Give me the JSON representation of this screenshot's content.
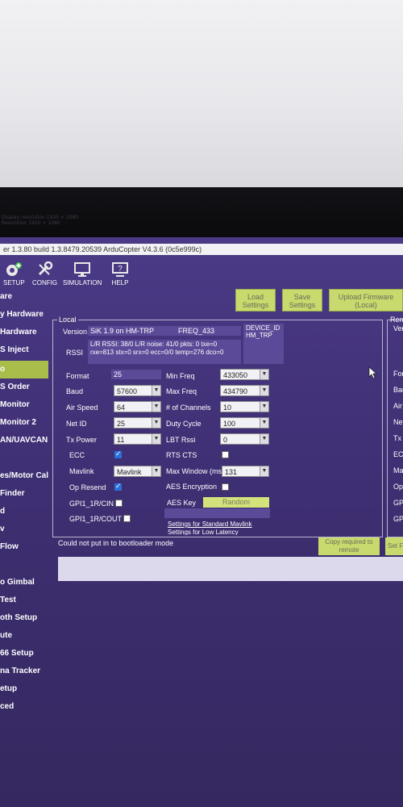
{
  "bezel_text": [
    "Display resolution 1920 × 1080",
    "Resolution 1920 × 1080"
  ],
  "window": {
    "title": "er 1.3.80 build 1.3.8479.20539 ArduCopter V4.3.6 (0c5e999c)"
  },
  "toolbar": {
    "setup": "SETUP",
    "config": "CONFIG",
    "simulation": "SIMULATION",
    "help": "HELP"
  },
  "sidebar": {
    "items": [
      {
        "label": "are"
      },
      {
        "label": "y Hardware"
      },
      {
        "label": "Hardware"
      },
      {
        "label": "S Inject"
      },
      {
        "label": "o",
        "active": true
      },
      {
        "label": "S Order"
      },
      {
        "label": "Monitor"
      },
      {
        "label": "Monitor 2"
      },
      {
        "label": "AN/UAVCAN"
      },
      {
        "label": "es/Motor Calib"
      },
      {
        "label": "Finder"
      },
      {
        "label": "d"
      },
      {
        "label": "v"
      },
      {
        "label": "Flow"
      },
      {
        "label": "o Gimbal"
      },
      {
        "label": "Test"
      },
      {
        "label": "oth Setup"
      },
      {
        "label": "ute"
      },
      {
        "label": "66 Setup"
      },
      {
        "label": "na Tracker"
      },
      {
        "label": "etup"
      },
      {
        "label": "ced"
      }
    ]
  },
  "actions": {
    "load": "Load Settings",
    "save": "Save Settings",
    "upload": "Upload Firmware (Local)"
  },
  "local": {
    "title": "Local",
    "version_label": "Version",
    "version_value": "SiK 1.9 on HM-TRP",
    "freq_value": "FREQ_433",
    "device_id": "DEVICE_ID HM_TRP",
    "rssi_label": "RSSI",
    "rssi_line1": "L/R RSSI: 38/0  L/R noise: 41/0 pkts: 0  txe=0",
    "rssi_line2": "rxe=813 stx=0 srx=0 ecc=0/0 temp=276 dco=0",
    "format_label": "Format",
    "format_value": "25",
    "baud_label": "Baud",
    "baud_value": "57600",
    "airspeed_label": "Air Speed",
    "airspeed_value": "64",
    "netid_label": "Net ID",
    "netid_value": "25",
    "txpower_label": "Tx Power",
    "txpower_value": "11",
    "ecc_label": "ECC",
    "ecc_checked": true,
    "mavlink_label": "Mavlink",
    "mavlink_value": "Mavlink",
    "opresend_label": "Op Resend",
    "opresend_checked": true,
    "gpi1_cin_label": "GPI1_1R/CIN",
    "gpi1_cout_label": "GPI1_1R/COUT",
    "minfreq_label": "Min Freq",
    "minfreq_value": "433050",
    "maxfreq_label": "Max Freq",
    "maxfreq_value": "434790",
    "channels_label": "# of Channels",
    "channels_value": "10",
    "duty_label": "Duty Cycle",
    "duty_value": "100",
    "lbt_label": "LBT Rssi",
    "lbt_value": "0",
    "rtscts_label": "RTS CTS",
    "maxwindow_label": "Max Window (ms)",
    "maxwindow_value": "131",
    "aesenc_label": "AES Encryption",
    "aeskey_label": "AES Key",
    "random_button": "Random",
    "link_mavlink": "Settings for Standard Mavlink",
    "link_latency": "Settings for Low Latency"
  },
  "remote": {
    "title": "Rem",
    "labels": [
      "Ver",
      "For",
      "Bau",
      "Air",
      "Net",
      "Tx",
      "EC",
      "Ma",
      "Op",
      "GPI",
      "GPI"
    ]
  },
  "status_text": "Could not put in to bootloader mode",
  "copy_button": "Copy required to remote",
  "set_button": "Set F"
}
